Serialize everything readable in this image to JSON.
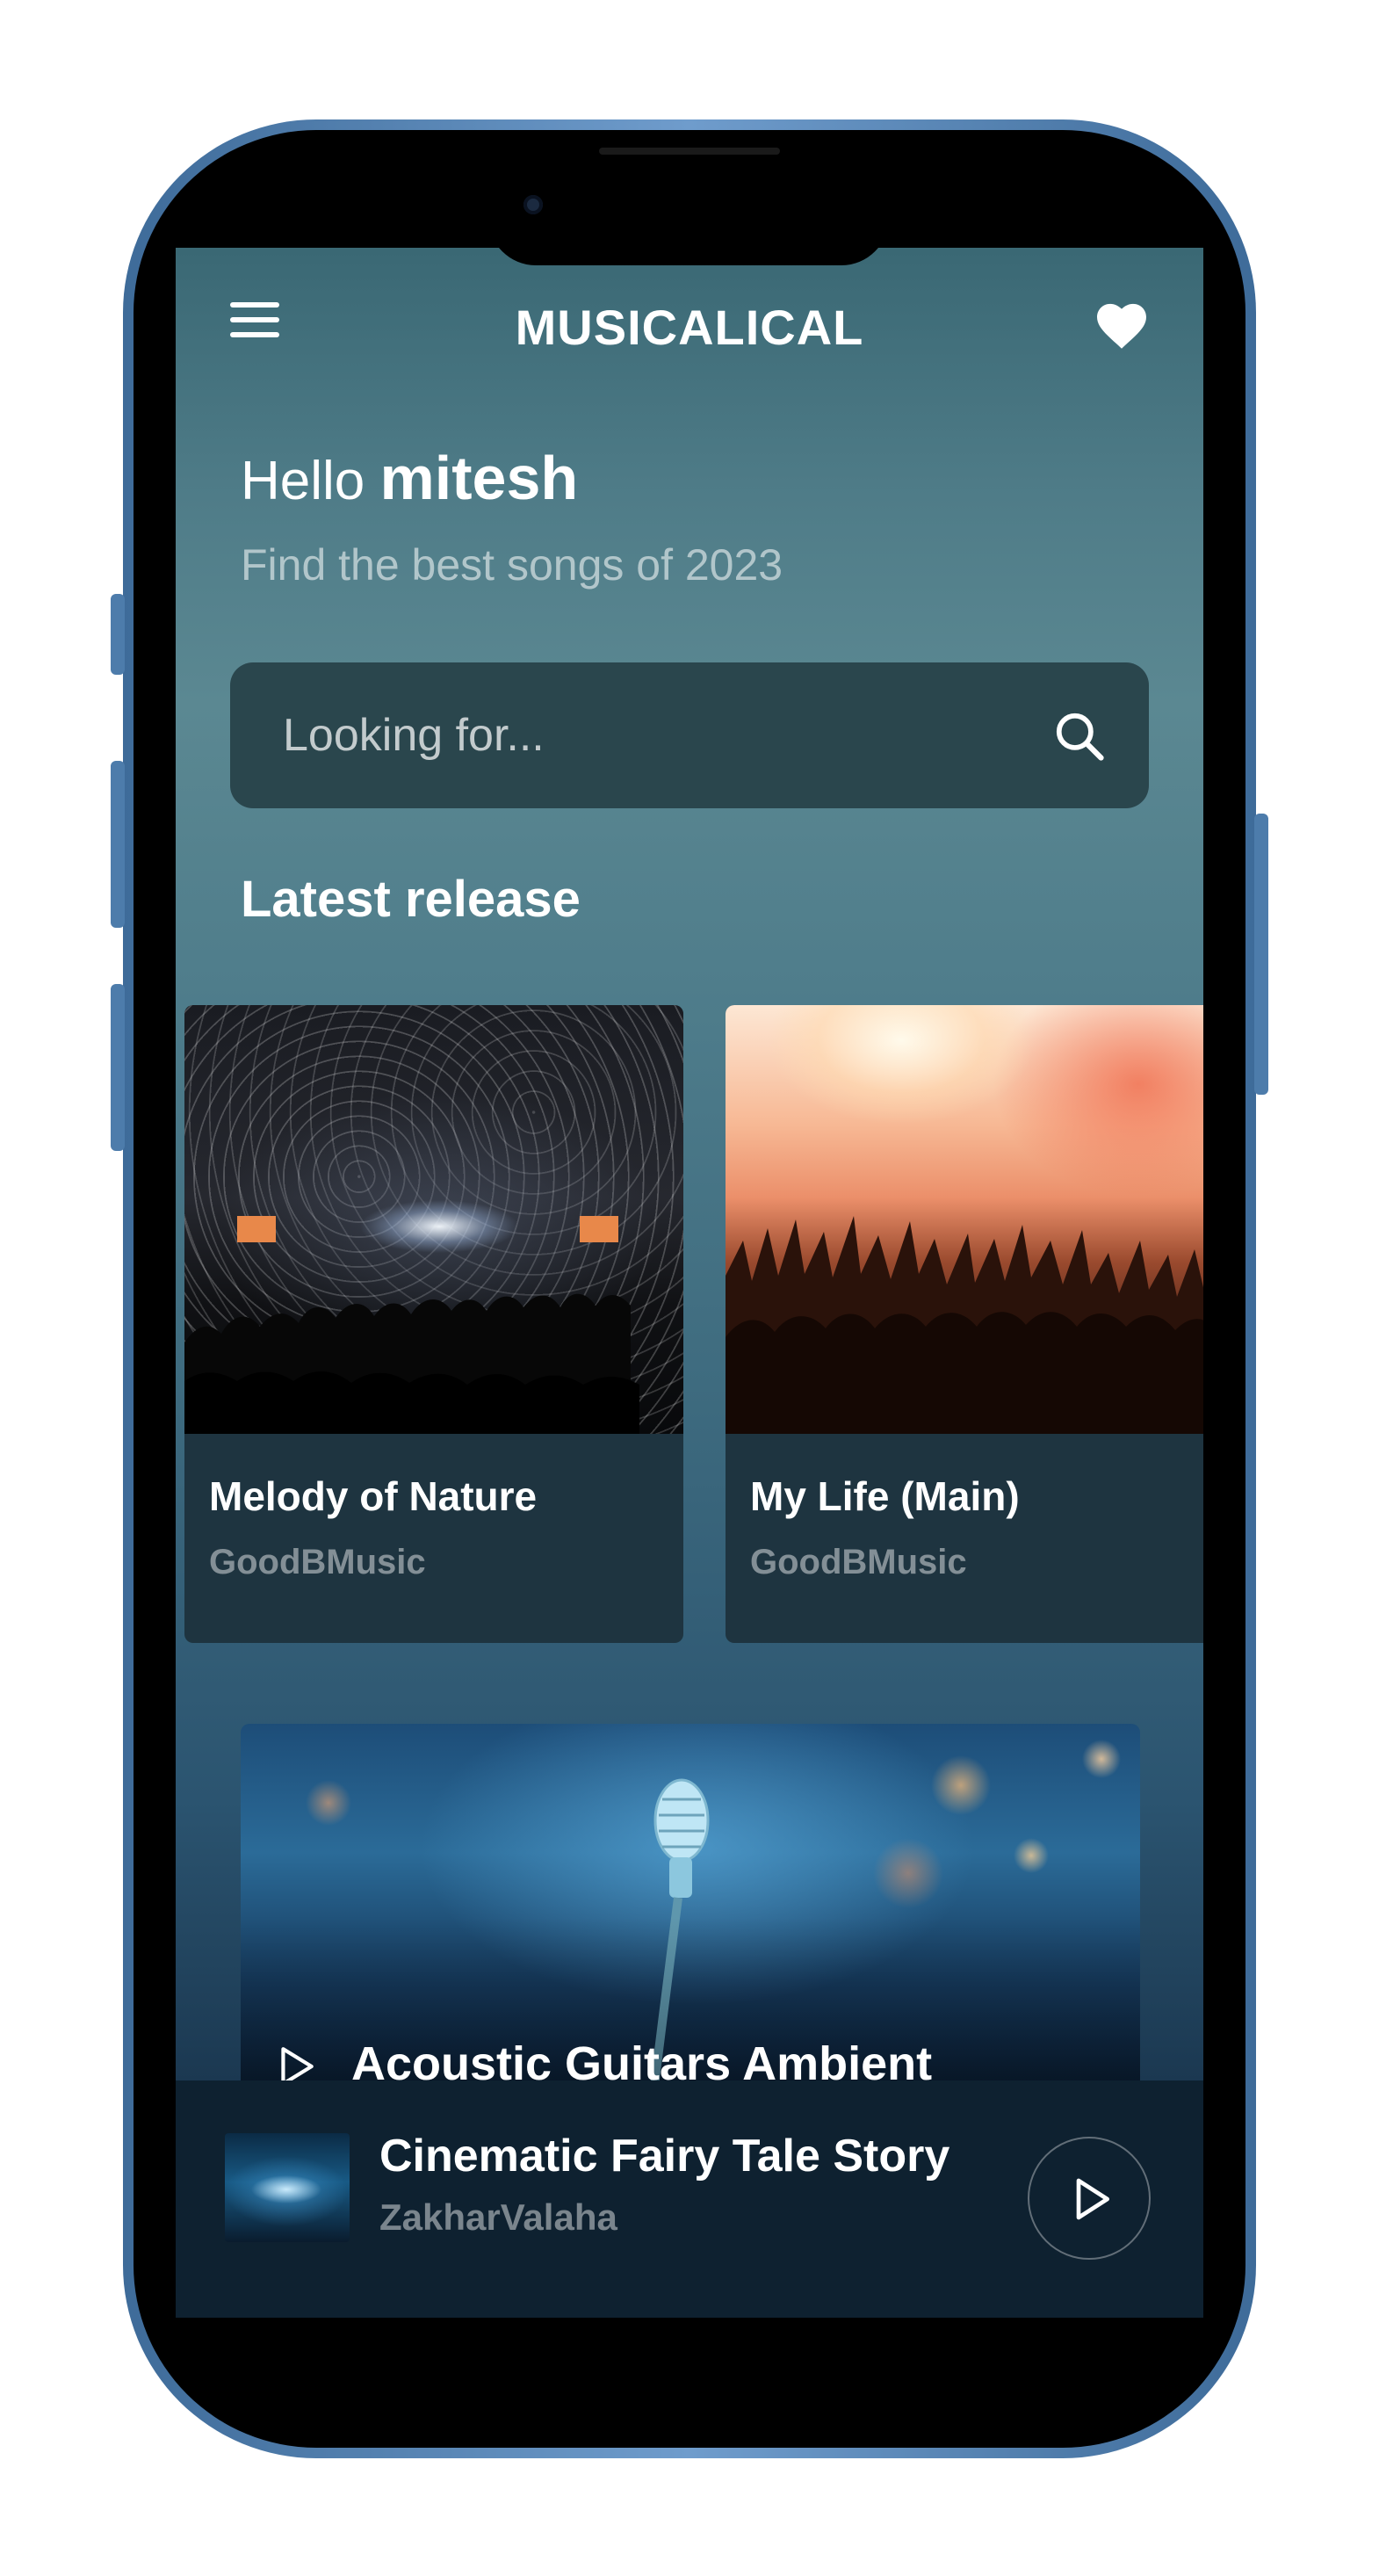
{
  "app": {
    "title": "MUSICALICAL"
  },
  "greeting": {
    "hello": "Hello",
    "name": "mitesh",
    "subtitle": "Find the best songs of 2023"
  },
  "search": {
    "placeholder": "Looking for..."
  },
  "latest": {
    "heading": "Latest release",
    "cards": [
      {
        "title": "Melody of Nature",
        "artist": "GoodBMusic"
      },
      {
        "title": "My Life (Main)",
        "artist": "GoodBMusic"
      }
    ]
  },
  "featured": {
    "title": "Acoustic Guitars Ambient"
  },
  "now_playing": {
    "title": "Cinematic Fairy Tale Story",
    "artist": "ZakharValaha"
  },
  "icons": {
    "menu": "hamburger-menu-icon",
    "favorites": "heart-icon",
    "search": "search-icon",
    "play": "play-icon"
  },
  "colors": {
    "search_bg": "#2a464d",
    "player_bg": "#0e2130",
    "frame": "#5b8bbf"
  }
}
